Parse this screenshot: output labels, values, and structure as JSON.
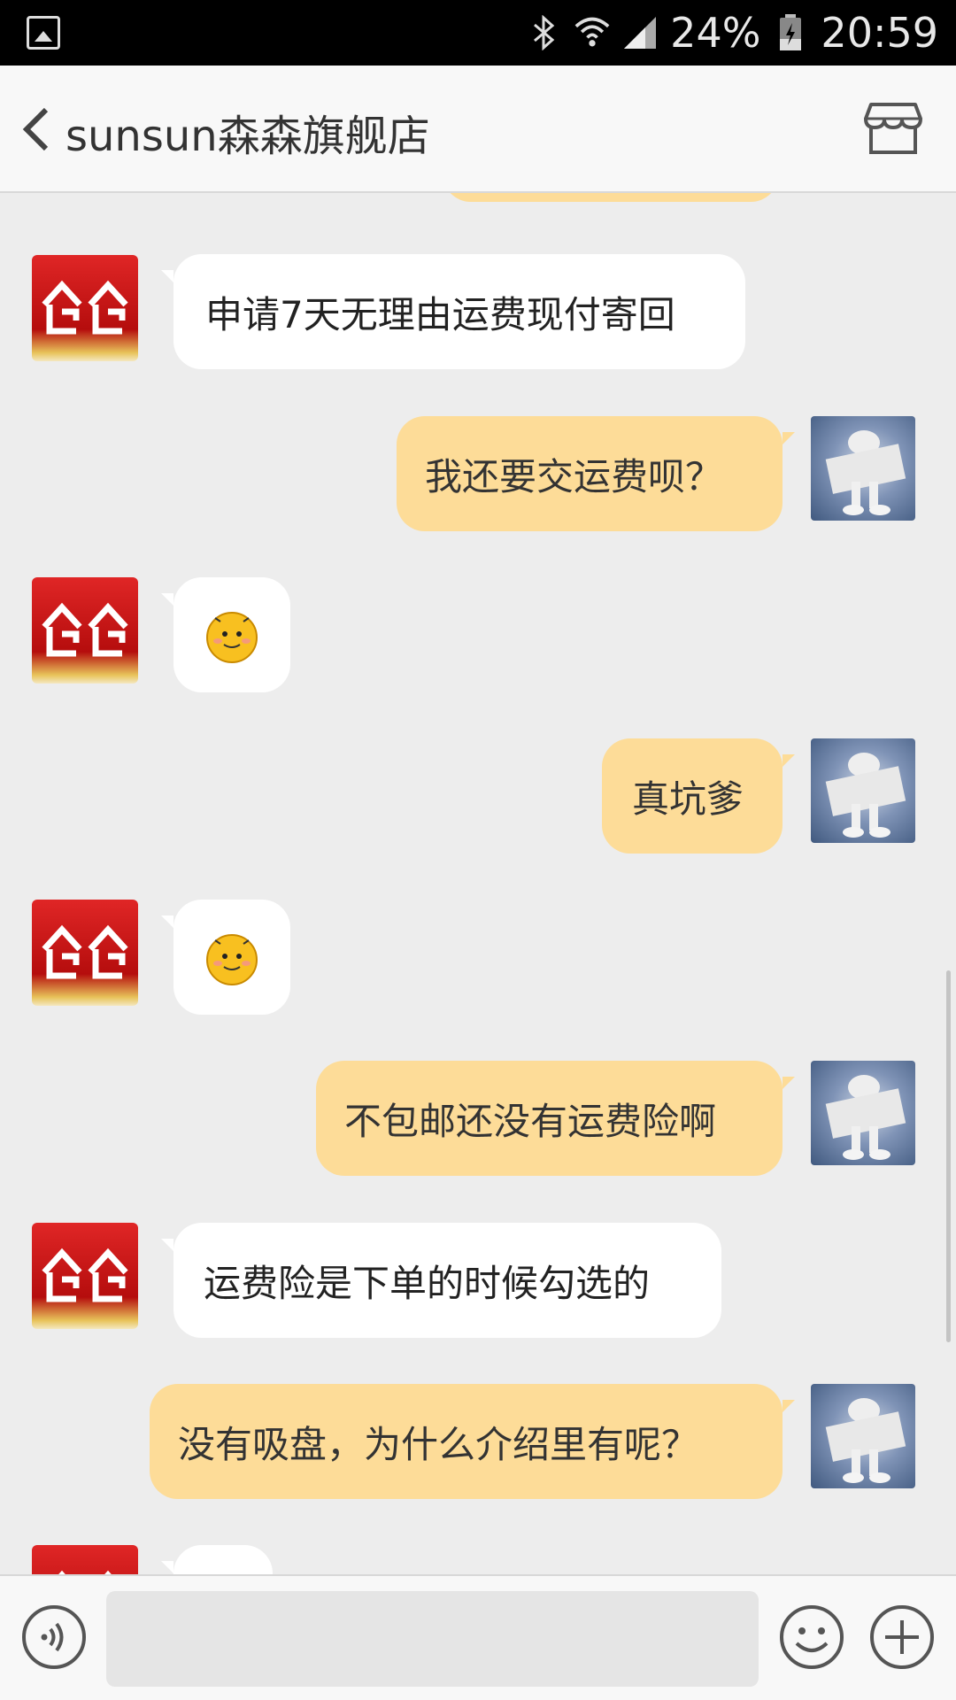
{
  "status_bar": {
    "battery": "24%",
    "time": "20:59"
  },
  "header": {
    "title": "sunsun森森旗舰店"
  },
  "messages": [
    {
      "side": "left",
      "type": "text",
      "text": "申请7天无理由运费现付寄回"
    },
    {
      "side": "right",
      "type": "text",
      "text": "我还要交运费呗？"
    },
    {
      "side": "left",
      "type": "emoji",
      "emoji": "smiley-emoji"
    },
    {
      "side": "right",
      "type": "text",
      "text": "真坑爹"
    },
    {
      "side": "left",
      "type": "emoji",
      "emoji": "smiley-emoji"
    },
    {
      "side": "right",
      "type": "text",
      "text": "不包邮还没有运费险啊"
    },
    {
      "side": "left",
      "type": "text",
      "text": "运费险是下单的时候勾选的"
    },
    {
      "side": "right",
      "type": "text",
      "text": "没有吸盘，为什么介绍里有呢？"
    }
  ],
  "input": {
    "value": "",
    "placeholder": ""
  },
  "colors": {
    "chat_background": "#ededed",
    "left_bubble": "#ffffff",
    "right_bubble": "#fddc98",
    "status_bar": "#000000"
  }
}
